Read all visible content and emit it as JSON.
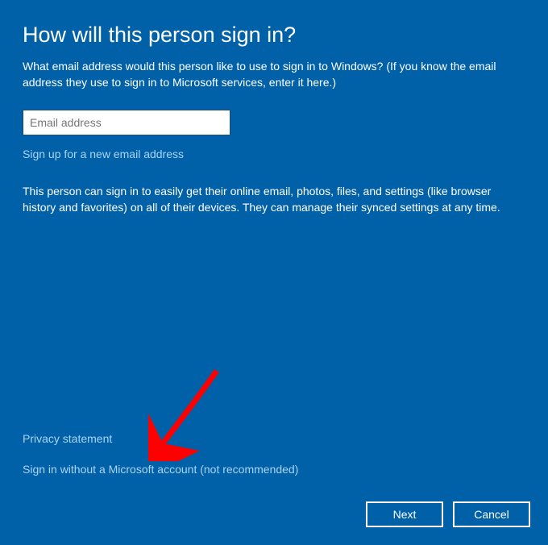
{
  "heading": "How will this person sign in?",
  "subtitle": "What email address would this person like to use to sign in to Windows? (If you know the email address they use to sign in to Microsoft services, enter it here.)",
  "email": {
    "value": "",
    "placeholder": "Email address"
  },
  "links": {
    "signup": "Sign up for a new email address",
    "privacy": "Privacy statement",
    "no_account": "Sign in without a Microsoft account (not recommended)"
  },
  "description": "This person can sign in to easily get their online email, photos, files, and settings (like browser history and favorites) on all of their devices. They can manage their synced settings at any time.",
  "buttons": {
    "next": "Next",
    "cancel": "Cancel"
  }
}
